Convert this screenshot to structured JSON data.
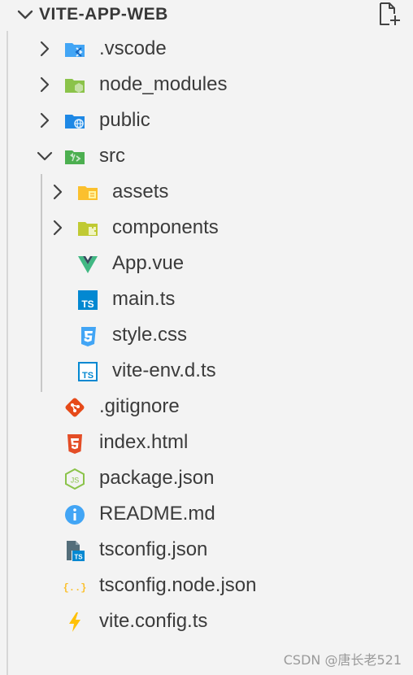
{
  "header": {
    "title": "VITE-APP-WEB"
  },
  "tree": {
    "vscode": ".vscode",
    "node_modules": "node_modules",
    "public": "public",
    "src": "src",
    "assets": "assets",
    "components": "components",
    "app_vue": "App.vue",
    "main_ts": "main.ts",
    "style_css": "style.css",
    "vite_env": "vite-env.d.ts",
    "gitignore": ".gitignore",
    "index_html": "index.html",
    "package_json": "package.json",
    "readme": "README.md",
    "tsconfig": "tsconfig.json",
    "tsconfig_node": "tsconfig.node.json",
    "vite_config": "vite.config.ts"
  },
  "icon_glyphs": {
    "ts": "TS",
    "json": "{..}",
    "js": "JS"
  },
  "watermark": "CSDN @唐长老521",
  "colors": {
    "text": "#3b3b3b",
    "folder_blue": "#42a5f5",
    "folder_green": "#8bc34a",
    "folder_yellow": "#fbc02d",
    "folder_lime": "#c0ca33",
    "ts_blue": "#0288d1",
    "vue_green": "#41b883",
    "vue_dark": "#35495e",
    "css_blue": "#42a5f5",
    "git_orange": "#e64a19",
    "html_orange": "#e44d26",
    "info_blue": "#42a5f5",
    "json_yellow": "#fbc02d",
    "vite_yellow": "#ffc107"
  }
}
